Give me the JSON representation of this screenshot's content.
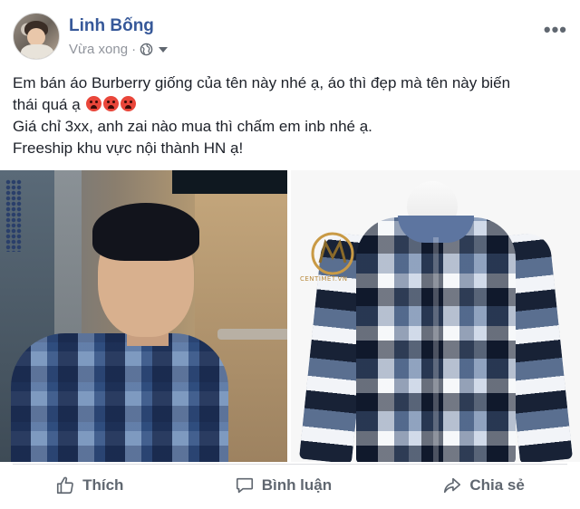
{
  "post": {
    "author": "Linh Bống",
    "time": "Vừa xong",
    "separator": "·",
    "lines": [
      "Em bán áo Burberry giống của tên này nhé ạ, áo thì đẹp mà tên này biến",
      "thái quá ạ",
      "Giá chỉ 3xx, anh zai nào mua thì chấm em inb nhé ạ.",
      "Freeship khu vực nội thành HN ạ!"
    ],
    "emoji_count": 3,
    "emoji_icon": "pouting-face-icon",
    "privacy_icon": "globe-icon",
    "watermark_text": "CENTIMET.VN"
  },
  "actions": {
    "like": "Thích",
    "comment": "Bình luận",
    "share": "Chia sẻ"
  },
  "colors": {
    "name": "#365899",
    "meta": "#90949c",
    "action": "#606770"
  }
}
